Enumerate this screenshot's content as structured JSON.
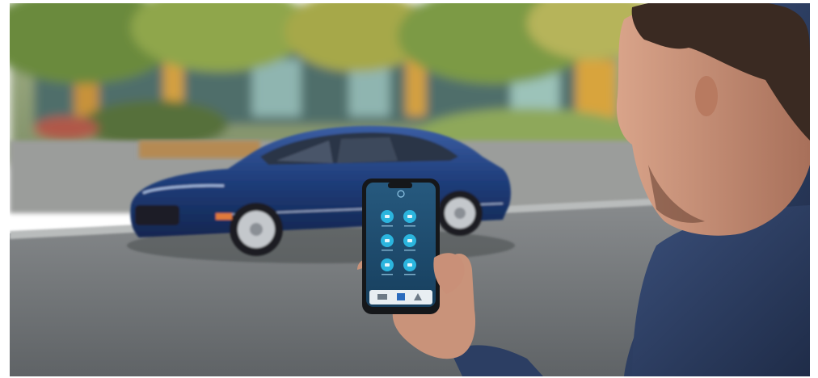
{
  "scene": {
    "subject": "person-holding-phone",
    "colors": {
      "car_blue": "#1f3d7a",
      "phone_screen": "#1d4a6e",
      "app_button": "#2bb5de",
      "jacket": "#2c3e63",
      "skin": "#c9937a",
      "hair": "#3a2a22",
      "road": "#6e7276",
      "foliage": "#7e9a4a"
    }
  },
  "phone_app": {
    "buttons": [
      {
        "icon": "remote-start-icon"
      },
      {
        "icon": "remote-stop-icon"
      },
      {
        "icon": "door-lock-icon"
      },
      {
        "icon": "door-unlock-icon"
      },
      {
        "icon": "horn-icon"
      },
      {
        "icon": "lights-icon"
      }
    ],
    "nav_icons": [
      "car-icon",
      "remote-icon",
      "location-icon"
    ]
  }
}
